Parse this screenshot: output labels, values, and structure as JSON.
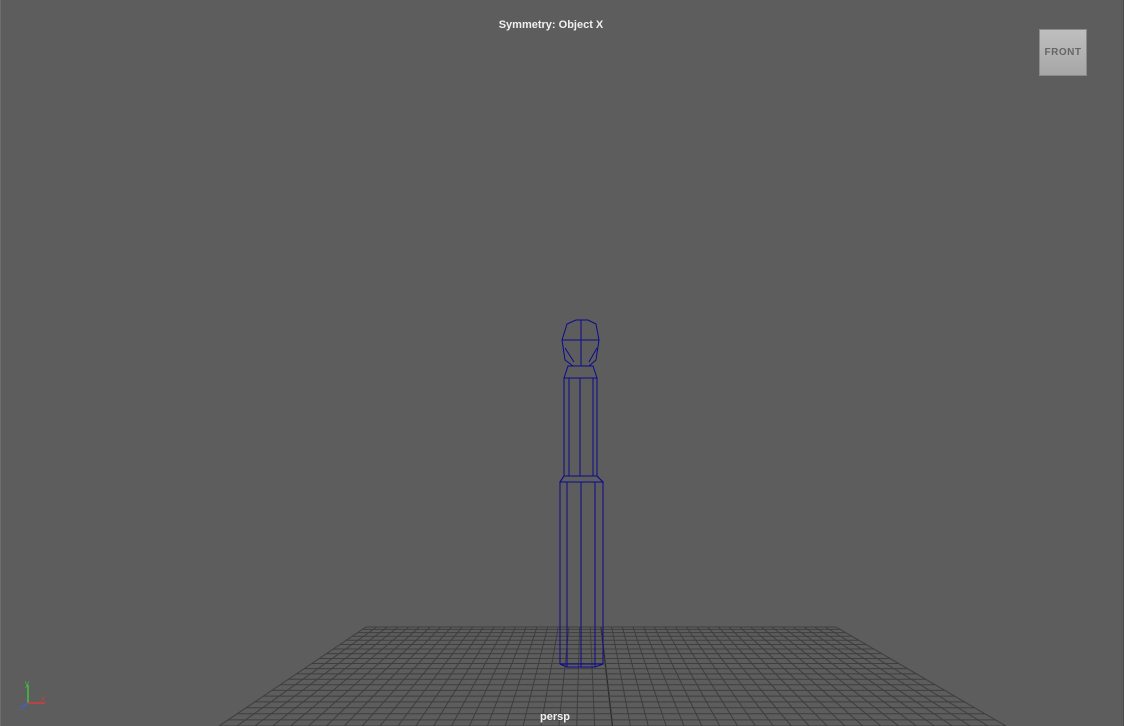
{
  "viewport": {
    "symmetry_label": "Symmetry: Object X",
    "camera_label": "persp",
    "view_cube_face": "FRONT"
  },
  "colors": {
    "background": "#5d5d5d",
    "grid": "#3e3e3e",
    "wireframe": "#0b0b8c",
    "axis_x": "#d73c3c",
    "axis_y": "#43c243",
    "axis_z": "#3c62d7"
  },
  "axis_indicator": {
    "labels": [
      "x",
      "y",
      "z"
    ]
  }
}
